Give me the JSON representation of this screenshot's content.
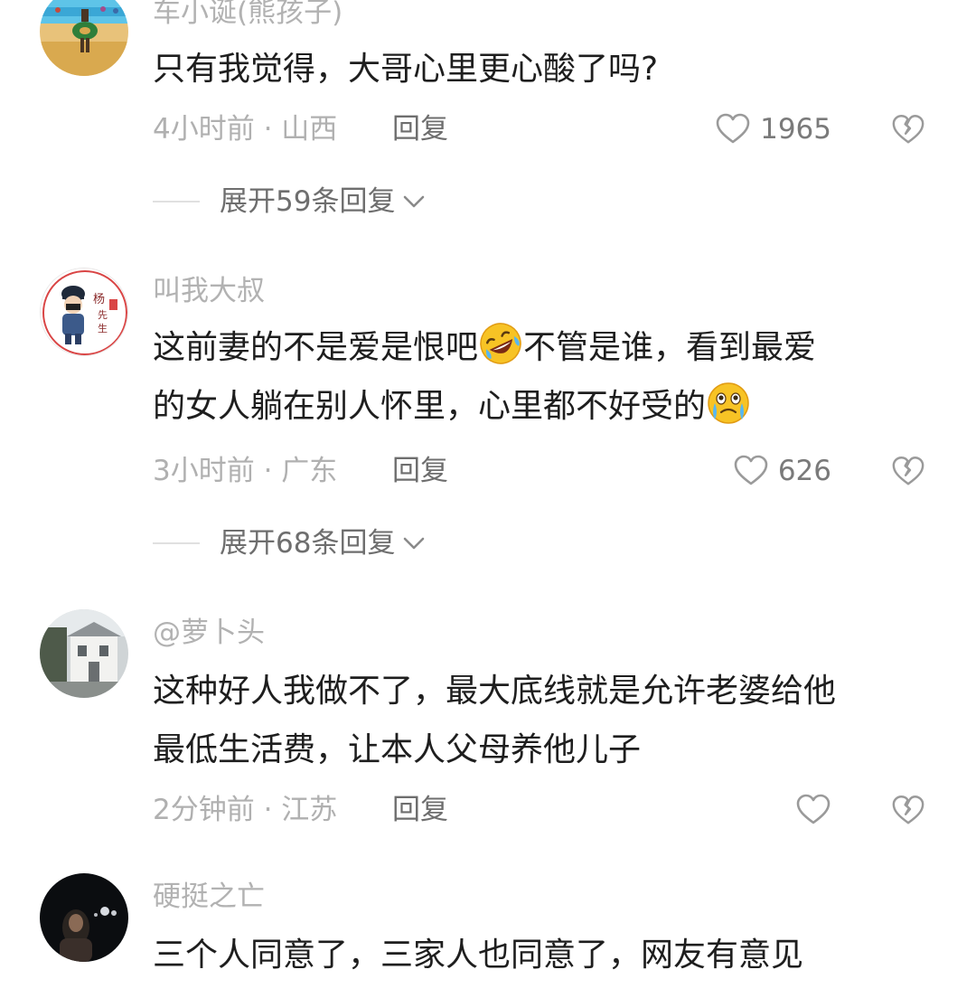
{
  "comments": [
    {
      "username": "车小诞(熊孩子)",
      "lines": [
        [
          "只有我觉得，大哥心里更心酸了吗?"
        ]
      ],
      "meta": "4小时前 · 山西",
      "reply_label": "回复",
      "likes": "1965",
      "expand_label": "展开59条回复"
    },
    {
      "username": "叫我大叔",
      "lines": [
        [
          "这前妻的不是爱是恨吧",
          "不管是谁，看到最爱"
        ],
        [
          "的女人躺在别人怀里，心里都不好受的"
        ]
      ],
      "meta": "3小时前 · 广东",
      "reply_label": "回复",
      "likes": "626",
      "expand_label": "展开68条回复"
    },
    {
      "username": "@萝卜头",
      "lines": [
        [
          "这种好人我做不了，最大底线就是允许老婆给他"
        ],
        [
          "最低生活费，让本人父母养他儿子"
        ]
      ],
      "meta": "2分钟前 · 江苏",
      "reply_label": "回复"
    },
    {
      "username": "硬挺之亡",
      "lines": [
        [
          "三个人同意了，三家人也同意了，网友有意见"
        ]
      ]
    }
  ],
  "avatar_seal_text": [
    "杨",
    "先",
    "生"
  ],
  "icons": {
    "like": "heart-outline-icon",
    "dislike": "broken-heart-icon",
    "expand": "chevron-down-icon",
    "emoji_1": "rofl-emoji",
    "emoji_2": "crying-emoji"
  },
  "colors": {
    "username": "#b2b2b2",
    "body_text": "#1e1e1e",
    "meta": "#b0b0b0",
    "action": "#6e6e6e"
  }
}
